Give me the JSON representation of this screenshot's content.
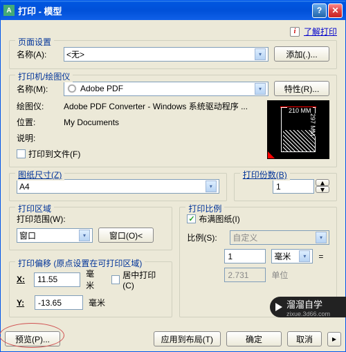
{
  "title": "打印 - 模型",
  "help_link": "了解打印",
  "page_setup": {
    "legend": "页面设置",
    "name_label": "名称(A):",
    "name_value": "<无>",
    "add_btn": "添加(.)..."
  },
  "printer": {
    "legend": "打印机/绘图仪",
    "name_label": "名称(M):",
    "name_value": "Adobe PDF",
    "props_btn": "特性(R)...",
    "plotter_label": "绘图仪:",
    "plotter_value": "Adobe PDF Converter - Windows 系统驱动程序 ...",
    "location_label": "位置:",
    "location_value": "My Documents",
    "desc_label": "说明:",
    "tofile_label": "打印到文件(F)",
    "preview_w": "210 MM",
    "preview_h": "297 MM"
  },
  "paper": {
    "legend": "图纸尺寸(Z)",
    "value": "A4"
  },
  "copies": {
    "legend": "打印份数(B)",
    "value": "1"
  },
  "area": {
    "legend": "打印区域",
    "range_label": "打印范围(W):",
    "range_value": "窗口",
    "window_btn": "窗口(O)<"
  },
  "scale": {
    "legend": "打印比例",
    "fit_label": "布满图纸(I)",
    "ratio_label": "比例(S):",
    "ratio_value": "自定义",
    "num1": "1",
    "unit1": "毫米",
    "num2": "2.731",
    "unit2": "单位"
  },
  "offset": {
    "legend": "打印偏移 (原点设置在可打印区域)",
    "x_label": "X:",
    "x_value": "11.55",
    "y_label": "Y:",
    "y_value": "-13.65",
    "unit": "毫米",
    "center_label": "居中打印(C)"
  },
  "buttons": {
    "preview": "预览(P)...",
    "apply": "应用到布局(T)",
    "ok": "确定",
    "cancel": "取消"
  },
  "watermark": {
    "main": "溜溜自学",
    "sub": "zixue.3d66.com"
  }
}
